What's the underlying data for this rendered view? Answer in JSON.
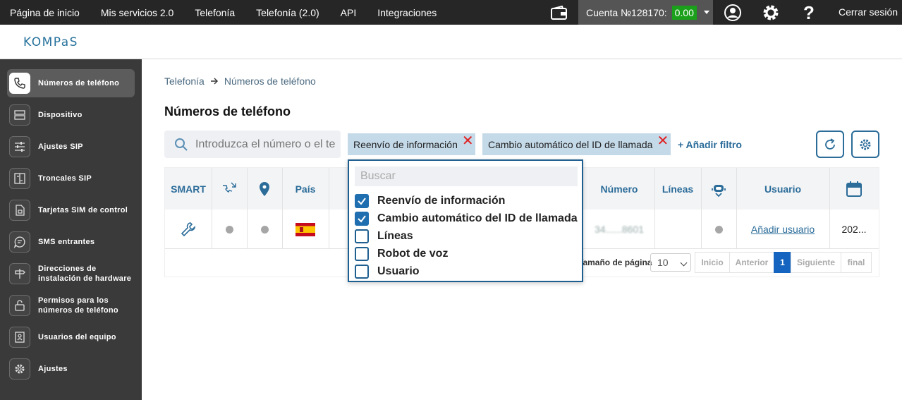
{
  "topbar": {
    "nav": [
      "Página de inicio",
      "Mis servicios 2.0",
      "Telefonía",
      "Telefonía (2.0)",
      "API",
      "Integraciones"
    ],
    "account_label": "Cuenta №128170:",
    "balance": "0.00",
    "logout": "Cerrar sesión"
  },
  "logo": "KOMPaS",
  "sidebar": {
    "items": [
      {
        "label": "Números de teléfono",
        "icon": "phone-icon",
        "active": true
      },
      {
        "label": "Dispositivo",
        "icon": "server-icon"
      },
      {
        "label": "Ajustes SIP",
        "icon": "sliders-icon"
      },
      {
        "label": "Troncales SIP",
        "icon": "trunk-icon"
      },
      {
        "label": "Tarjetas SIM de control",
        "icon": "sim-card-icon"
      },
      {
        "label": "SMS entrantes",
        "icon": "message-icon"
      },
      {
        "label": "Direcciones de instalación de hardware",
        "icon": "signpost-icon"
      },
      {
        "label": "Permisos para los números de teléfono",
        "icon": "lock-icon"
      },
      {
        "label": "Usuarios del equipo",
        "icon": "users-icon"
      },
      {
        "label": "Ajustes",
        "icon": "gear-icon"
      }
    ]
  },
  "breadcrumb": {
    "root": "Telefonía",
    "current": "Números de teléfono"
  },
  "page_title": "Números de teléfono",
  "search": {
    "placeholder": "Introduzca el número o el te"
  },
  "filters": {
    "chips": [
      "Reenvío de información",
      "Cambio automático del ID de llamada"
    ],
    "add_filter": "+ Añadir filtro"
  },
  "table": {
    "headers": {
      "smart": "SMART",
      "country": "País",
      "number": "Número",
      "lines": "Líneas",
      "user": "Usuario"
    },
    "row": {
      "number": "34......8601",
      "add_user": "Añadir usuario",
      "date": "202..."
    }
  },
  "pagination": {
    "page_size_label": "Tamaño de página",
    "page_size": "10",
    "first": "Inicio",
    "prev": "Anterior",
    "current": "1",
    "next": "Siguiente",
    "last": "final"
  },
  "dropdown": {
    "search_placeholder": "Buscar",
    "options": [
      {
        "label": "Reenvío de información",
        "checked": true
      },
      {
        "label": "Cambio automático del ID de llamada",
        "checked": true
      },
      {
        "label": "Líneas",
        "checked": false
      },
      {
        "label": "Robot de voz",
        "checked": false
      },
      {
        "label": "Usuario",
        "checked": false
      }
    ]
  },
  "colors": {
    "accent": "#2b6c99",
    "balance_bg": "#1aa01a",
    "sidebar_bg": "#3a3a3a",
    "chip_bg": "#c5dae9"
  }
}
